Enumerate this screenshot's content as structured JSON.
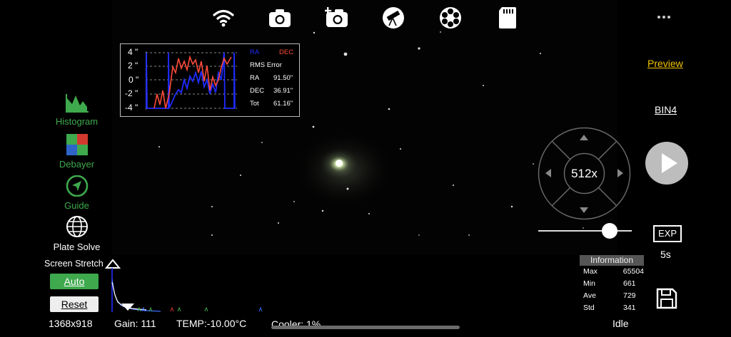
{
  "top_icons": [
    "wifi-icon",
    "camera-icon",
    "camera-add-icon",
    "telescope-icon",
    "filter-wheel-icon",
    "sd-card-icon",
    "more-icon"
  ],
  "tools": [
    {
      "name": "histogram",
      "label": "Histogram",
      "icon": "histogram-icon",
      "color": "#3fa94d"
    },
    {
      "name": "debayer",
      "label": "Debayer",
      "icon": "debayer-icon",
      "color": "#3fa94d"
    },
    {
      "name": "guide",
      "label": "Guide",
      "icon": "guide-icon",
      "color": "#3fa94d"
    },
    {
      "name": "plate-solve",
      "label": "Plate Solve",
      "icon": "globe-icon",
      "color": "#ffffff"
    }
  ],
  "guide_graph": {
    "y_ticks": [
      "4 \"",
      "2 \"",
      "0 \"",
      "-2 \"",
      "-4 \""
    ],
    "legend_ra": "RA",
    "legend_dec": "DEC",
    "ra_color": "#1f2cff",
    "dec_color": "#ff4a3a",
    "rms_title": "RMS Error",
    "rms": [
      {
        "label": "RA",
        "value": "91.50\""
      },
      {
        "label": "DEC",
        "value": "36.91\""
      },
      {
        "label": "Tot",
        "value": "61.16\""
      }
    ]
  },
  "stretch": {
    "label": "Screen Stretch",
    "auto": "Auto",
    "reset": "Reset"
  },
  "status": {
    "resolution": "1368x918",
    "gain": "Gain: 111",
    "temp": "TEMP:-10.00°C",
    "cooler": "Cooler: 1%",
    "state": "Idle"
  },
  "right": {
    "preview": "Preview",
    "bin": "BIN4",
    "zoom": "512x",
    "exp": "EXP",
    "exposure": "5s",
    "slider_level": 0.82,
    "accent": "#f2c200"
  },
  "info": {
    "title": "Information",
    "rows": [
      {
        "label": "Max",
        "value": "65504"
      },
      {
        "label": "Min",
        "value": "661"
      },
      {
        "label": "Ave",
        "value": "729"
      },
      {
        "label": "Std",
        "value": "341"
      }
    ]
  }
}
